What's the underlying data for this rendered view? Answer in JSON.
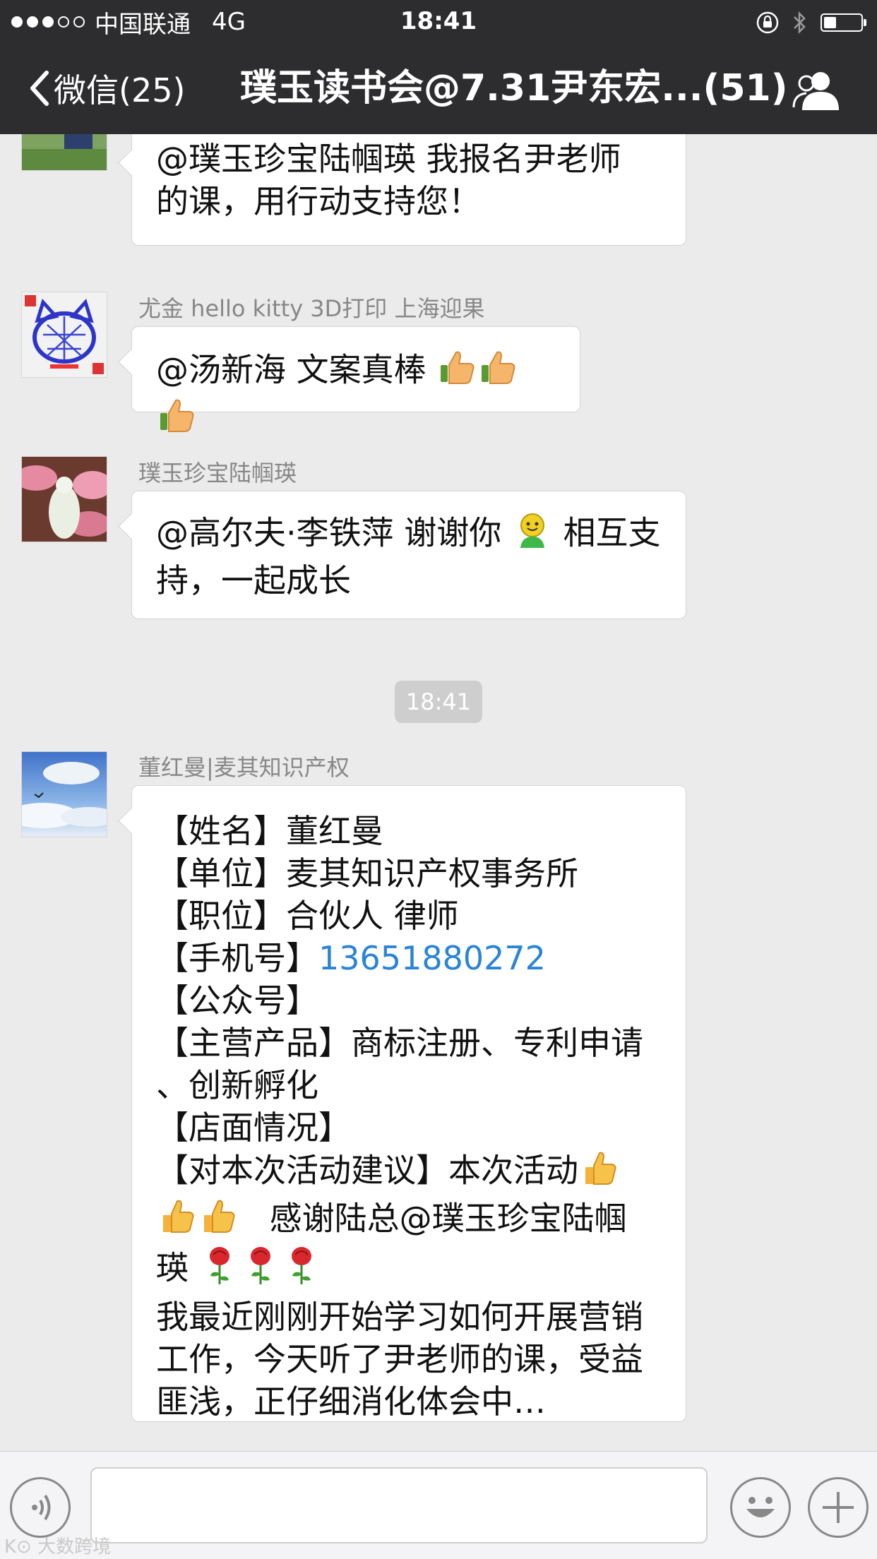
{
  "status_bar": {
    "carrier": "中国联通",
    "network": "4G",
    "time": "18:41",
    "signal_bars_filled": 3,
    "signal_bars_total": 5,
    "battery_level": 0.3
  },
  "nav": {
    "back_label": "微信(25)",
    "title": "璞玉读书会@7.31尹东宏...(51)",
    "group_icon": "group-members-icon"
  },
  "messages": [
    {
      "sender": "",
      "lines": [
        "@璞玉珍宝陆帼瑛 我报名尹老师",
        "的课，用行动支持您！"
      ]
    },
    {
      "sender": "尤金 hello kitty 3D打印 上海迎果",
      "text": "@汤新海 文案真棒",
      "emoji": "thumbs-up ×3"
    },
    {
      "sender": "璞玉珍宝陆帼瑛",
      "line1_a": "@高尔夫·李铁萍 谢谢你",
      "line1_b": "相互支",
      "line2": "持，一起成长"
    },
    {
      "sender": "董红曼|麦其知识产权",
      "name": "【姓名】董红曼",
      "company": "【单位】麦其知识产权事务所",
      "position": "【职位】合伙人 律师",
      "phone_label": "【手机号】",
      "phone": "13651880272",
      "official_account": "【公众号】",
      "products_line1": "【主营产品】商标注册、专利申请",
      "products_line2": "、创新孵化",
      "store": "【店面情况】",
      "suggestion_line1": "【对本次活动建议】本次活动",
      "suggestion_line2": "感谢陆总@璞玉珍宝陆帼",
      "suggestion_line3": "瑛",
      "tail_line1": "我最近刚刚开始学习如何开展营销",
      "tail_line2": "工作，今天听了尹老师的课，受益",
      "tail_line3": "匪浅，正仔细消化体会中…"
    }
  ],
  "timestamp_chip": "18:41",
  "input_bar": {
    "voice_icon": "voice-icon",
    "emoji_icon": "emoji-smile-icon",
    "plus_icon": "plus-icon"
  },
  "watermark": "大数跨境",
  "colors": {
    "header_bg": "#2d2d30",
    "chat_bg": "#ebebeb",
    "link": "#2b84d8"
  }
}
